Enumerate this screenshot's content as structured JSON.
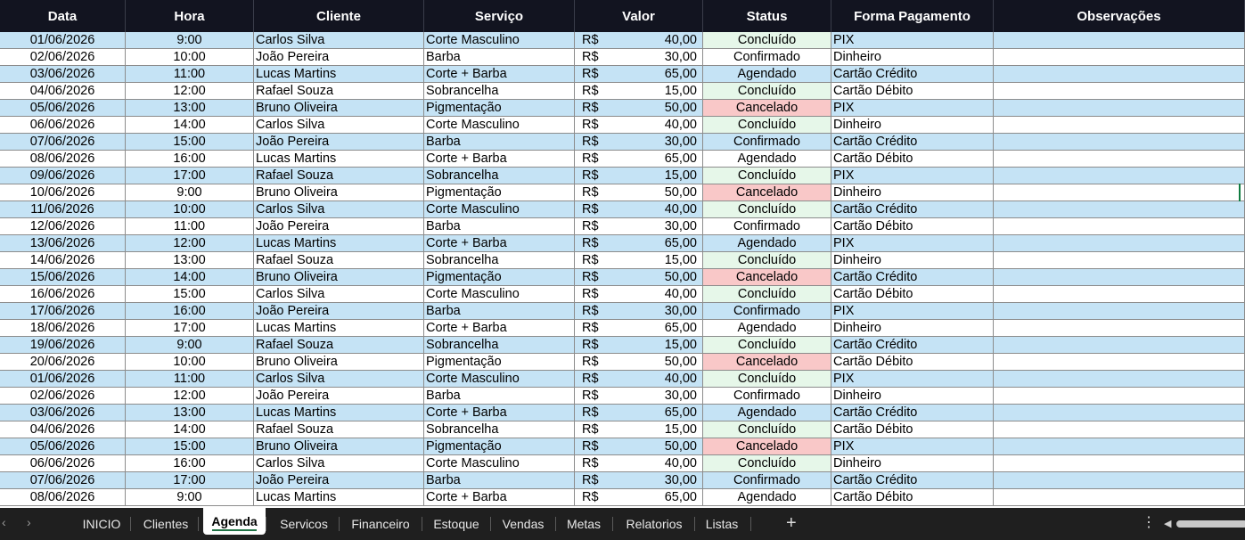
{
  "colors": {
    "header_bg": "#121420",
    "header_text": "#ffffff",
    "band_blue": "#c5e3f5",
    "band_white": "#ffffff",
    "status_concluido": "#e6f7e9",
    "status_cancelado": "#f9c8c8",
    "tabbar_bg": "#1f1f1f",
    "active_tab_underline": "#217346"
  },
  "columns": [
    "Data",
    "Hora",
    "Cliente",
    "Serviço",
    "Valor",
    "Status",
    "Forma Pagamento",
    "Observações"
  ],
  "currency_symbol": "R$",
  "rows": [
    {
      "data": "01/06/2026",
      "hora": "9:00",
      "cliente": "Carlos Silva",
      "servico": "Corte Masculino",
      "valor": "40,00",
      "status": "Concluído",
      "pagamento": "PIX",
      "obs": ""
    },
    {
      "data": "02/06/2026",
      "hora": "10:00",
      "cliente": "João Pereira",
      "servico": "Barba",
      "valor": "30,00",
      "status": "Confirmado",
      "pagamento": "Dinheiro",
      "obs": ""
    },
    {
      "data": "03/06/2026",
      "hora": "11:00",
      "cliente": "Lucas Martins",
      "servico": "Corte + Barba",
      "valor": "65,00",
      "status": "Agendado",
      "pagamento": "Cartão Crédito",
      "obs": ""
    },
    {
      "data": "04/06/2026",
      "hora": "12:00",
      "cliente": "Rafael Souza",
      "servico": "Sobrancelha",
      "valor": "15,00",
      "status": "Concluído",
      "pagamento": "Cartão Débito",
      "obs": ""
    },
    {
      "data": "05/06/2026",
      "hora": "13:00",
      "cliente": "Bruno Oliveira",
      "servico": "Pigmentação",
      "valor": "50,00",
      "status": "Cancelado",
      "pagamento": "PIX",
      "obs": ""
    },
    {
      "data": "06/06/2026",
      "hora": "14:00",
      "cliente": "Carlos Silva",
      "servico": "Corte Masculino",
      "valor": "40,00",
      "status": "Concluído",
      "pagamento": "Dinheiro",
      "obs": ""
    },
    {
      "data": "07/06/2026",
      "hora": "15:00",
      "cliente": "João Pereira",
      "servico": "Barba",
      "valor": "30,00",
      "status": "Confirmado",
      "pagamento": "Cartão Crédito",
      "obs": ""
    },
    {
      "data": "08/06/2026",
      "hora": "16:00",
      "cliente": "Lucas Martins",
      "servico": "Corte + Barba",
      "valor": "65,00",
      "status": "Agendado",
      "pagamento": "Cartão Débito",
      "obs": ""
    },
    {
      "data": "09/06/2026",
      "hora": "17:00",
      "cliente": "Rafael Souza",
      "servico": "Sobrancelha",
      "valor": "15,00",
      "status": "Concluído",
      "pagamento": "PIX",
      "obs": ""
    },
    {
      "data": "10/06/2026",
      "hora": "9:00",
      "cliente": "Bruno Oliveira",
      "servico": "Pigmentação",
      "valor": "50,00",
      "status": "Cancelado",
      "pagamento": "Dinheiro",
      "obs": ""
    },
    {
      "data": "11/06/2026",
      "hora": "10:00",
      "cliente": "Carlos Silva",
      "servico": "Corte Masculino",
      "valor": "40,00",
      "status": "Concluído",
      "pagamento": "Cartão Crédito",
      "obs": ""
    },
    {
      "data": "12/06/2026",
      "hora": "11:00",
      "cliente": "João Pereira",
      "servico": "Barba",
      "valor": "30,00",
      "status": "Confirmado",
      "pagamento": "Cartão Débito",
      "obs": ""
    },
    {
      "data": "13/06/2026",
      "hora": "12:00",
      "cliente": "Lucas Martins",
      "servico": "Corte + Barba",
      "valor": "65,00",
      "status": "Agendado",
      "pagamento": "PIX",
      "obs": ""
    },
    {
      "data": "14/06/2026",
      "hora": "13:00",
      "cliente": "Rafael Souza",
      "servico": "Sobrancelha",
      "valor": "15,00",
      "status": "Concluído",
      "pagamento": "Dinheiro",
      "obs": ""
    },
    {
      "data": "15/06/2026",
      "hora": "14:00",
      "cliente": "Bruno Oliveira",
      "servico": "Pigmentação",
      "valor": "50,00",
      "status": "Cancelado",
      "pagamento": "Cartão Crédito",
      "obs": ""
    },
    {
      "data": "16/06/2026",
      "hora": "15:00",
      "cliente": "Carlos Silva",
      "servico": "Corte Masculino",
      "valor": "40,00",
      "status": "Concluído",
      "pagamento": "Cartão Débito",
      "obs": ""
    },
    {
      "data": "17/06/2026",
      "hora": "16:00",
      "cliente": "João Pereira",
      "servico": "Barba",
      "valor": "30,00",
      "status": "Confirmado",
      "pagamento": "PIX",
      "obs": ""
    },
    {
      "data": "18/06/2026",
      "hora": "17:00",
      "cliente": "Lucas Martins",
      "servico": "Corte + Barba",
      "valor": "65,00",
      "status": "Agendado",
      "pagamento": "Dinheiro",
      "obs": ""
    },
    {
      "data": "19/06/2026",
      "hora": "9:00",
      "cliente": "Rafael Souza",
      "servico": "Sobrancelha",
      "valor": "15,00",
      "status": "Concluído",
      "pagamento": "Cartão Crédito",
      "obs": ""
    },
    {
      "data": "20/06/2026",
      "hora": "10:00",
      "cliente": "Bruno Oliveira",
      "servico": "Pigmentação",
      "valor": "50,00",
      "status": "Cancelado",
      "pagamento": "Cartão Débito",
      "obs": ""
    },
    {
      "data": "01/06/2026",
      "hora": "11:00",
      "cliente": "Carlos Silva",
      "servico": "Corte Masculino",
      "valor": "40,00",
      "status": "Concluído",
      "pagamento": "PIX",
      "obs": ""
    },
    {
      "data": "02/06/2026",
      "hora": "12:00",
      "cliente": "João Pereira",
      "servico": "Barba",
      "valor": "30,00",
      "status": "Confirmado",
      "pagamento": "Dinheiro",
      "obs": ""
    },
    {
      "data": "03/06/2026",
      "hora": "13:00",
      "cliente": "Lucas Martins",
      "servico": "Corte + Barba",
      "valor": "65,00",
      "status": "Agendado",
      "pagamento": "Cartão Crédito",
      "obs": ""
    },
    {
      "data": "04/06/2026",
      "hora": "14:00",
      "cliente": "Rafael Souza",
      "servico": "Sobrancelha",
      "valor": "15,00",
      "status": "Concluído",
      "pagamento": "Cartão Débito",
      "obs": ""
    },
    {
      "data": "05/06/2026",
      "hora": "15:00",
      "cliente": "Bruno Oliveira",
      "servico": "Pigmentação",
      "valor": "50,00",
      "status": "Cancelado",
      "pagamento": "PIX",
      "obs": ""
    },
    {
      "data": "06/06/2026",
      "hora": "16:00",
      "cliente": "Carlos Silva",
      "servico": "Corte Masculino",
      "valor": "40,00",
      "status": "Concluído",
      "pagamento": "Dinheiro",
      "obs": ""
    },
    {
      "data": "07/06/2026",
      "hora": "17:00",
      "cliente": "João Pereira",
      "servico": "Barba",
      "valor": "30,00",
      "status": "Confirmado",
      "pagamento": "Cartão Crédito",
      "obs": ""
    },
    {
      "data": "08/06/2026",
      "hora": "9:00",
      "cliente": "Lucas Martins",
      "servico": "Corte + Barba",
      "valor": "65,00",
      "status": "Agendado",
      "pagamento": "Cartão Débito",
      "obs": ""
    }
  ],
  "sheet_tabs": {
    "nav_prev_icon": "chevron-left-icon",
    "nav_next_icon": "chevron-right-icon",
    "tabs": [
      "INICIO",
      "Clientes",
      "Agenda",
      "Servicos",
      "Financeiro",
      "Estoque",
      "Vendas",
      "Metas",
      "Relatorios",
      "Listas"
    ],
    "active": "Agenda",
    "add_sheet_icon": "plus-icon",
    "options_icon": "more-vertical-icon",
    "scrollbar_icon": "caret-left-icon"
  }
}
